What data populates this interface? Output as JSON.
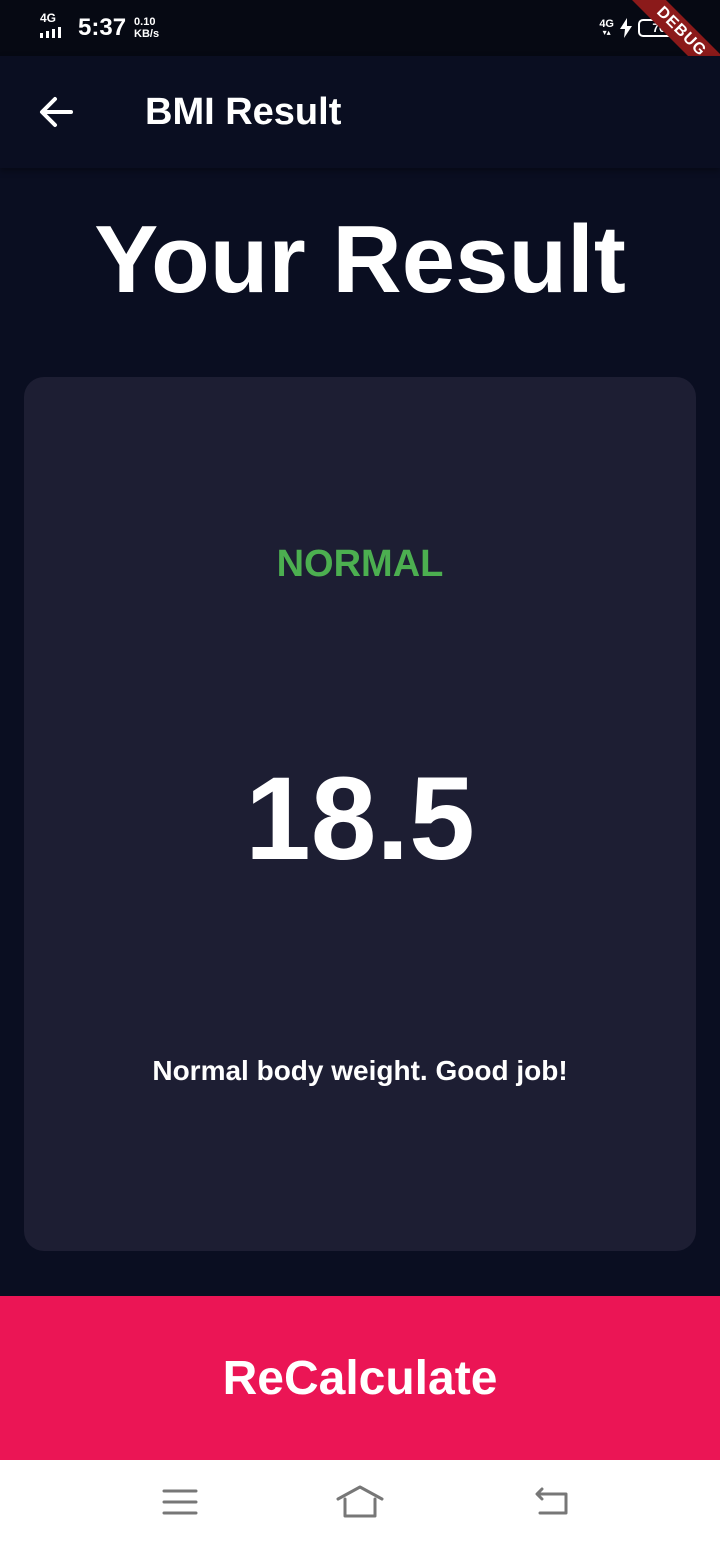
{
  "status_bar": {
    "network_left": "4G",
    "time": "5:37",
    "speed_value": "0.10",
    "speed_unit": "KB/s",
    "network_right": "4G",
    "battery_level": "70",
    "debug_label": "DEBUG",
    "icons": [
      "signal-icon",
      "charging-icon",
      "battery-icon"
    ]
  },
  "app_bar": {
    "title": "BMI Result",
    "back_icon": "arrow-left-icon"
  },
  "main": {
    "heading": "Your Result",
    "card": {
      "status": "NORMAL",
      "bmi": "18.5",
      "message": "Normal body weight. Good job!"
    },
    "recalculate_label": "ReCalculate"
  },
  "nav_bar": {
    "icons": [
      "menu-icon",
      "home-icon",
      "back-icon"
    ]
  },
  "colors": {
    "background": "#0a0e21",
    "card": "#1d1e33",
    "status_normal": "#4caf50",
    "accent": "#eb1555",
    "debug_ribbon": "#8b1a1a"
  }
}
